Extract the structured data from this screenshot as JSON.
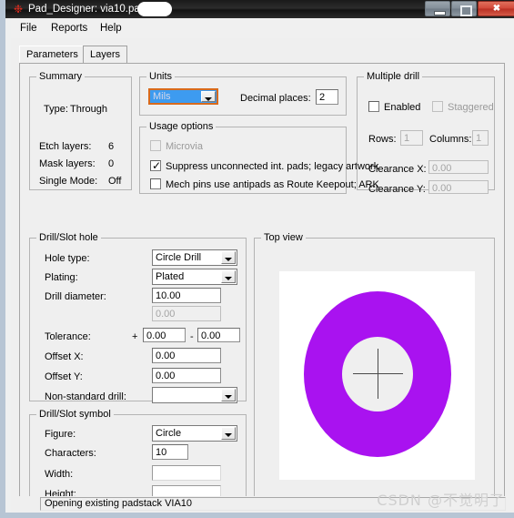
{
  "window": {
    "title": "Pad_Designer: via10.pad",
    "icon": "app-icon",
    "minimize_label": "",
    "maximize_label": "",
    "close_label": "✖"
  },
  "menubar": {
    "items": [
      {
        "label": "File"
      },
      {
        "label": "Reports"
      },
      {
        "label": "Help"
      }
    ]
  },
  "tabs": [
    {
      "label": "Parameters",
      "active": true
    },
    {
      "label": "Layers",
      "active": false
    }
  ],
  "summary": {
    "legend": "Summary",
    "type_label": "Type:",
    "type_value": "Through",
    "etch_label": "Etch layers:",
    "etch_value": "6",
    "mask_label": "Mask layers:",
    "mask_value": "0",
    "single_mode_label": "Single Mode:",
    "single_mode_value": "Off"
  },
  "units": {
    "legend": "Units",
    "value": "Mils",
    "decimal_label": "Decimal places:",
    "decimal_value": "2"
  },
  "usage_options": {
    "legend": "Usage options",
    "items": [
      {
        "label": "Microvia",
        "checked": false,
        "enabled": false
      },
      {
        "label": "Suppress unconnected int. pads; legacy artwork",
        "checked": true,
        "enabled": true
      },
      {
        "label": "Mech pins use antipads as Route Keepout; ARK",
        "checked": false,
        "enabled": true
      }
    ]
  },
  "multiple_drill": {
    "legend": "Multiple drill",
    "enabled_label": "Enabled",
    "enabled_checked": false,
    "staggered_label": "Staggered",
    "staggered_checked": false,
    "rows_label": "Rows:",
    "rows_value": "1",
    "columns_label": "Columns:",
    "columns_value": "1",
    "clearance_x_label": "Clearance X:",
    "clearance_x_value": "0.00",
    "clearance_y_label": "Clearance Y:",
    "clearance_y_value": "0.00"
  },
  "drill_slot_hole": {
    "legend": "Drill/Slot hole",
    "hole_type_label": "Hole type:",
    "hole_type_value": "Circle Drill",
    "plating_label": "Plating:",
    "plating_value": "Plated",
    "drill_diameter_label": "Drill diameter:",
    "drill_diameter_value": "10.00",
    "drill_diameter_second_value": "0.00",
    "tolerance_label": "Tolerance:",
    "tolerance_plus_sign": "+",
    "tolerance_plus_value": "0.00",
    "tolerance_minus_sign": "-",
    "tolerance_minus_value": "0.00",
    "offset_x_label": "Offset X:",
    "offset_x_value": "0.00",
    "offset_y_label": "Offset Y:",
    "offset_y_value": "0.00",
    "non_standard_label": "Non-standard drill:",
    "non_standard_value": ""
  },
  "drill_slot_symbol": {
    "legend": "Drill/Slot symbol",
    "figure_label": "Figure:",
    "figure_value": "Circle",
    "characters_label": "Characters:",
    "characters_value": "10",
    "width_label": "Width:",
    "width_value": "",
    "height_label": "Height:",
    "height_value": ""
  },
  "top_view": {
    "legend": "Top view",
    "pad_color": "#a912f0",
    "hole_color": "#efefef",
    "canvas_color": "#ffffff",
    "crosshair_color": "#4a4a4a"
  },
  "statusbar": {
    "message": "Opening existing padstack VIA10"
  },
  "watermark": {
    "text": "CSDN @不觉明了"
  }
}
